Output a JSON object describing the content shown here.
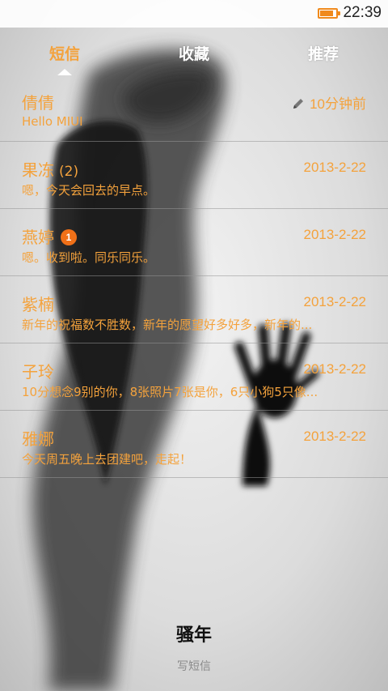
{
  "status": {
    "time": "22:39",
    "battery_level": 0.85,
    "accent_color": "#f08a1c"
  },
  "tabs": [
    {
      "label": "短信",
      "active": true
    },
    {
      "label": "收藏",
      "active": false
    },
    {
      "label": "推荐",
      "active": false
    }
  ],
  "threads": [
    {
      "contact": "倩倩",
      "count": "",
      "badge": "",
      "snippet": "Hello MIUI",
      "time": "10分钟前",
      "icon": "pencil-icon"
    },
    {
      "contact": "果冻",
      "count": "(2)",
      "badge": "",
      "snippet": "嗯，今天会回去的早点。",
      "time": "2013-2-22",
      "icon": ""
    },
    {
      "contact": "燕婷",
      "count": "",
      "badge": "1",
      "snippet": "嗯。收到啦。同乐同乐。",
      "time": "2013-2-22",
      "icon": ""
    },
    {
      "contact": "紫楠",
      "count": "",
      "badge": "",
      "snippet": "新年的祝福数不胜数，新年的愿望好多好多，新年的...",
      "time": "2013-2-22",
      "icon": ""
    },
    {
      "contact": "子玲",
      "count": "",
      "badge": "",
      "snippet": "10分想念9别的你，8张照片7张是你，6只小狗5只像...",
      "time": "2013-2-22",
      "icon": ""
    },
    {
      "contact": "雅娜",
      "count": "",
      "badge": "",
      "snippet": "今天周五晚上去团建吧，走起！",
      "time": "2013-2-22",
      "icon": ""
    }
  ],
  "bottom": {
    "title": "骚年",
    "compose_label": "写短信"
  },
  "colors": {
    "accent": "#f4a23c",
    "badge": "#f07018"
  }
}
